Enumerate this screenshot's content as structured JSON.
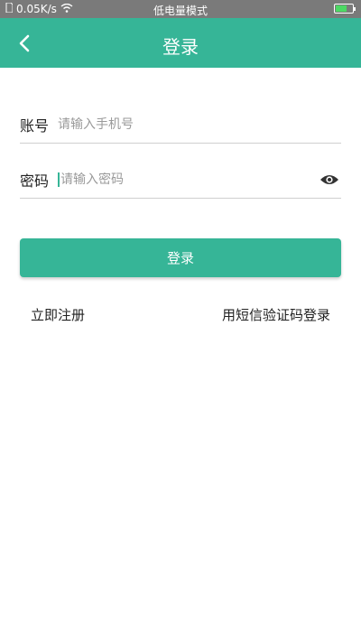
{
  "status_bar": {
    "speed": "0.05K/s",
    "mode": "低电量模式",
    "wifi_icon": "wifi-icon",
    "battery_icon": "battery-charging-icon"
  },
  "header": {
    "title": "登录",
    "back_icon": "chevron-left-icon"
  },
  "form": {
    "account_label": "账号",
    "account_placeholder": "请输入手机号",
    "password_label": "密码",
    "password_placeholder": "请输入密码",
    "toggle_icon": "eye-icon"
  },
  "actions": {
    "login_label": "登录",
    "register_label": "立即注册",
    "sms_login_label": "用短信验证码登录"
  },
  "colors": {
    "accent": "#36b597",
    "status_bar": "#7a7a7a"
  }
}
